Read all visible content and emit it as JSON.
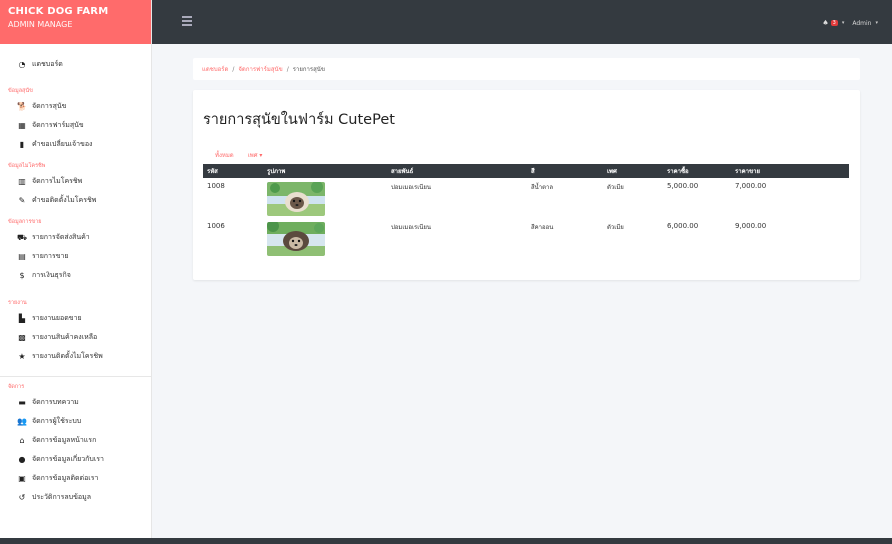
{
  "brand": {
    "title": "CHICK DOG FARM",
    "subtitle": "ADMIN MANAGE"
  },
  "colors": {
    "brand": "#ff6b6b",
    "navbar": "#343a40",
    "badge": "#e23b3b"
  },
  "sidebar": {
    "dashboard": {
      "icon": "dashboard-icon",
      "label": "แดชบอร์ด"
    },
    "sections": [
      {
        "title": "ข้อมูลสุนัข",
        "items": [
          {
            "icon": "dog-icon",
            "label": "จัดการสุนัข"
          },
          {
            "icon": "farm-icon",
            "label": "จัดการฟาร์มสุนัข"
          },
          {
            "icon": "bookmark-icon",
            "label": "คำขอเปลี่ยนเจ้าของ"
          }
        ]
      },
      {
        "title": "ข้อมูลไมโครชิพ",
        "items": [
          {
            "icon": "chip-icon",
            "label": "จัดการไมโครชิพ"
          },
          {
            "icon": "wrench-icon",
            "label": "คำขอติดตั้งไมโครชิพ"
          }
        ]
      },
      {
        "title": "ข้อมูลการขาย",
        "items": [
          {
            "icon": "truck-icon",
            "label": "รายการจัดส่งสินค้า"
          },
          {
            "icon": "cash-register-icon",
            "label": "รายการขาย"
          },
          {
            "icon": "dollar-icon",
            "label": "การเงินธุรกิจ"
          }
        ]
      },
      {
        "title": "รายงาน",
        "items": [
          {
            "icon": "file-icon",
            "label": "รายงานยอดขาย"
          },
          {
            "icon": "boxes-icon",
            "label": "รายงานสินค้าคงเหลือ"
          },
          {
            "icon": "star-icon",
            "label": "รายงานติดตั้งไมโครชิพ"
          }
        ]
      },
      {
        "title": "จัดการ",
        "items": [
          {
            "icon": "article-icon",
            "label": "จัดการบทความ"
          },
          {
            "icon": "users-icon",
            "label": "จัดการผู้ใช้ระบบ"
          },
          {
            "icon": "home-icon",
            "label": "จัดการข้อมูลหน้าแรก"
          },
          {
            "icon": "info-icon",
            "label": "จัดการข้อมูลเกี่ยวกับเรา"
          },
          {
            "icon": "contact-card-icon",
            "label": "จัดการข้อมูลติดต่อเรา"
          },
          {
            "icon": "history-icon",
            "label": "ประวัติการลบข้อมูล"
          }
        ]
      }
    ]
  },
  "topbar": {
    "badge_count": "3",
    "user": "Admin"
  },
  "breadcrumb": {
    "home": "แดชบอร์ด",
    "farm": "จัดการฟาร์มสุนัข",
    "current": "รายการสุนัข"
  },
  "page": {
    "title": "รายการสุนัขในฟาร์ม CutePet"
  },
  "filters": {
    "all": "ทั้งหมด",
    "sex": "เพศ ▾"
  },
  "table": {
    "headers": [
      "รหัส",
      "รูปภาพ",
      "สายพันธ์",
      "สี",
      "เพศ",
      "ราคาซื้อ",
      "ราคาขาย"
    ],
    "rows": [
      {
        "id": "1008",
        "breed": "ปอมเมอเรเนียน",
        "color": "สีน้ำตาล",
        "sex": "ตัวเมีย",
        "buy": "5,000.00",
        "sell": "7,000.00"
      },
      {
        "id": "1006",
        "breed": "ปอมเมอเรเนียน",
        "color": "สีคาออน",
        "sex": "ตัวเมีย",
        "buy": "6,000.00",
        "sell": "9,000.00"
      }
    ]
  }
}
